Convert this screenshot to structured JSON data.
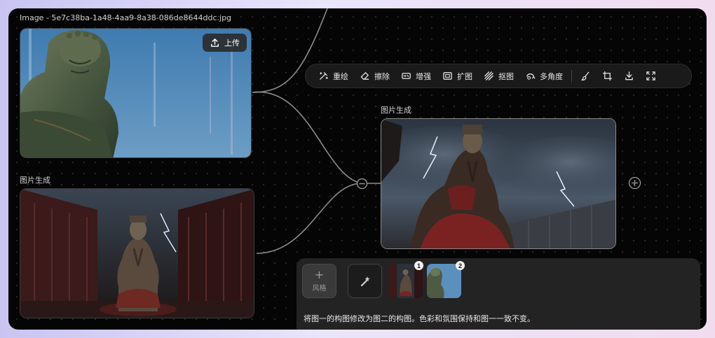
{
  "source_node": {
    "filename_label": "Image - 5e7c38ba-1a48-4aa9-8a38-086de8644ddc.jpg",
    "upload_label": "上传",
    "upload_icon": "upload-icon"
  },
  "generated_node_left": {
    "label": "图片生成"
  },
  "generated_node_right": {
    "label": "图片生成"
  },
  "toolbar": {
    "items": [
      {
        "label": "重绘",
        "icon": "repaint-icon"
      },
      {
        "label": "擦除",
        "icon": "eraser-icon"
      },
      {
        "label": "增强",
        "icon": "enhance-icon"
      },
      {
        "label": "扩图",
        "icon": "expand-image-icon"
      },
      {
        "label": "抠图",
        "icon": "cutout-icon"
      },
      {
        "label": "多角度",
        "icon": "multi-angle-icon"
      }
    ],
    "icon_only": [
      "brush-icon",
      "crop-icon",
      "download-icon",
      "fullscreen-icon"
    ]
  },
  "prompt_panel": {
    "style_label": "风格",
    "style_plus": "+",
    "reference_badges": [
      "1",
      "2"
    ],
    "prompt_text": "将图一的构图修改为图二的构图。色彩和氛围保持和图一一致不变。"
  },
  "colors": {
    "canvas_bg": "#050505",
    "panel_bg": "#232323",
    "toolbar_bg": "#1a1a1a",
    "sky_blue": "#4f86b3",
    "statue_red": "#7a1d1d"
  }
}
